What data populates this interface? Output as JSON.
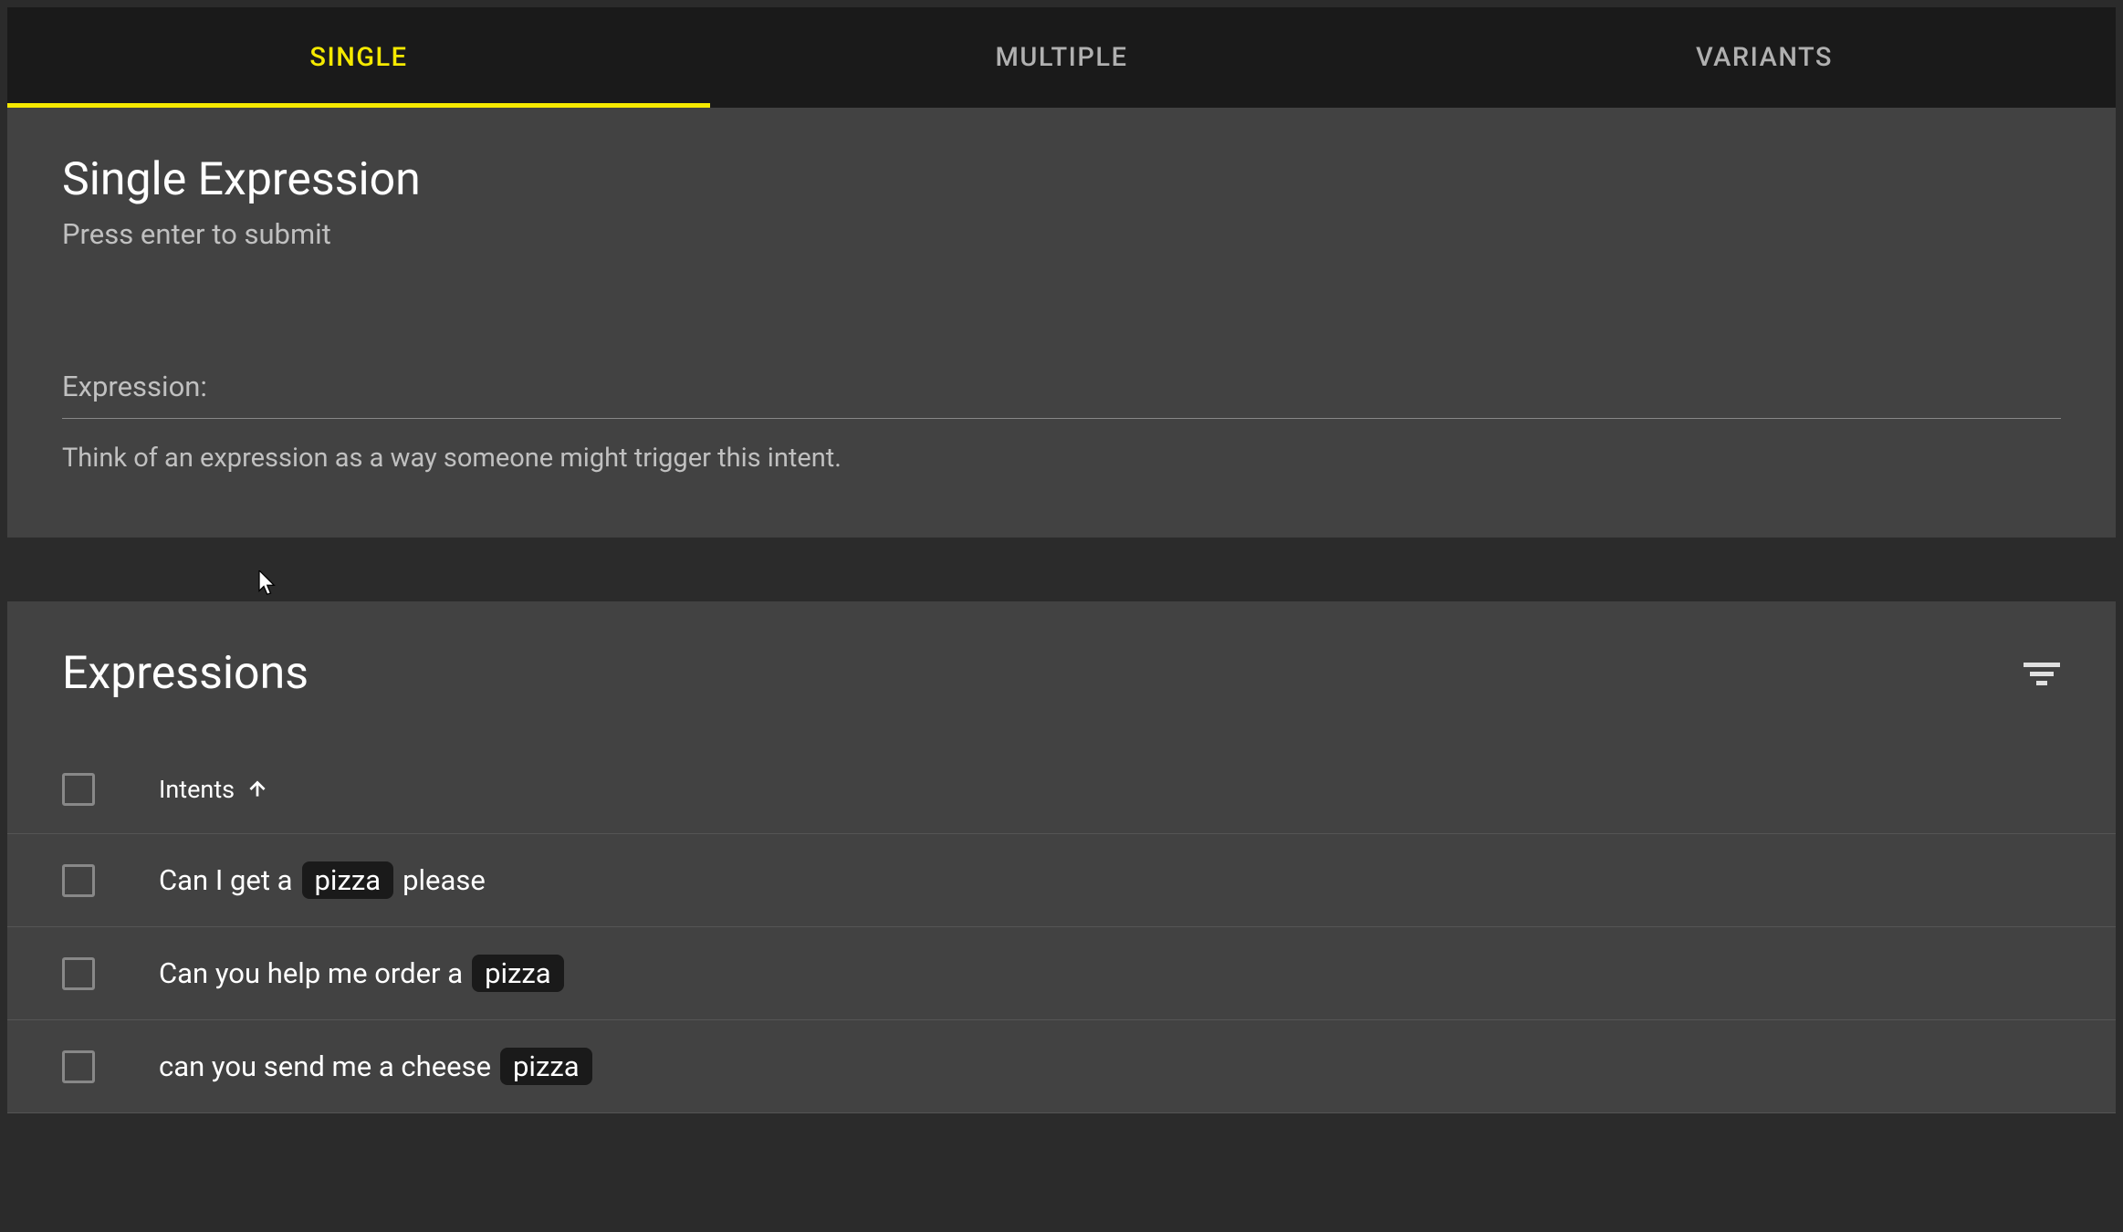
{
  "tabs": {
    "single": "SINGLE",
    "multiple": "MULTIPLE",
    "variants": "VARIANTS"
  },
  "panel": {
    "title": "Single Expression",
    "subtitle": "Press enter to submit",
    "inputLabel": "Expression:",
    "inputHint": "Think of an expression as a way someone might trigger this intent."
  },
  "expressionsPanel": {
    "title": "Expressions",
    "columnHeader": "Intents"
  },
  "rows": [
    {
      "parts": [
        {
          "type": "text",
          "value": "Can I get a"
        },
        {
          "type": "entity",
          "value": "pizza"
        },
        {
          "type": "text",
          "value": "please"
        }
      ]
    },
    {
      "parts": [
        {
          "type": "text",
          "value": "Can you help me order a"
        },
        {
          "type": "entity",
          "value": "pizza"
        }
      ]
    },
    {
      "parts": [
        {
          "type": "text",
          "value": "can you send me a cheese"
        },
        {
          "type": "entity",
          "value": "pizza"
        }
      ]
    }
  ]
}
